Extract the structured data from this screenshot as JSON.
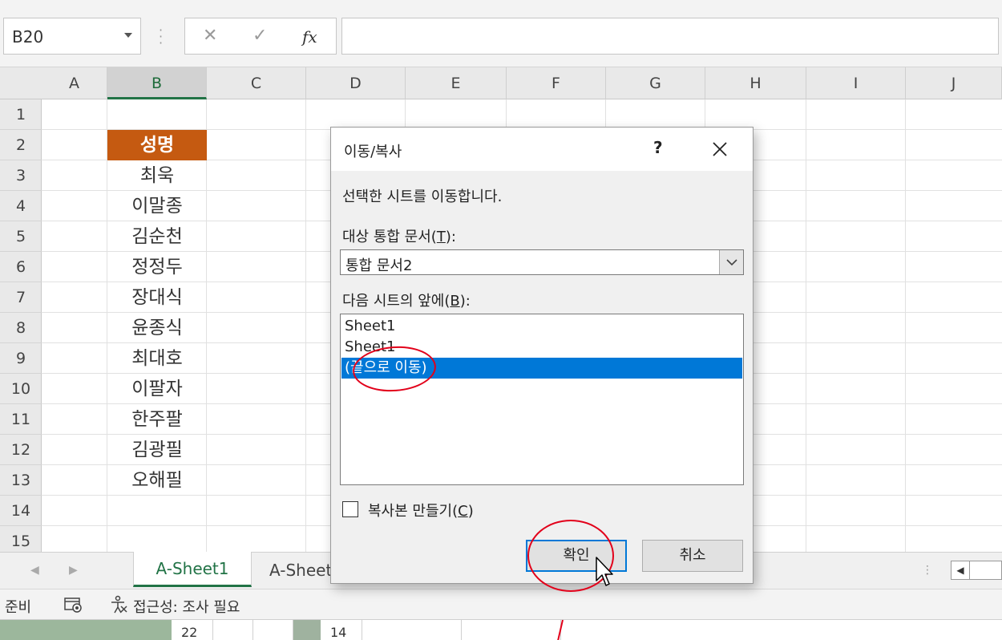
{
  "formula_bar": {
    "name_box": "B20",
    "cancel_symbol": "✕",
    "enter_symbol": "✓",
    "fx_symbol": "fx",
    "formula": ""
  },
  "columns": [
    "A",
    "B",
    "C",
    "D",
    "E",
    "F",
    "G",
    "H",
    "I",
    "J"
  ],
  "active_column": "B",
  "rows": [
    "1",
    "2",
    "3",
    "4",
    "5",
    "6",
    "7",
    "8",
    "9",
    "10",
    "11",
    "12",
    "13",
    "14",
    "15"
  ],
  "column_b": {
    "header": "성명",
    "names": [
      "최욱",
      "이말종",
      "김순천",
      "정정두",
      "장대식",
      "윤종식",
      "최대호",
      "이팔자",
      "한주팔",
      "김광필",
      "오해필"
    ]
  },
  "sheet_tabs": {
    "tabs": [
      "A-Sheet1",
      "A-Sheet"
    ],
    "active": "A-Sheet1"
  },
  "status_bar": {
    "ready": "준비",
    "accessibility": "접근성: 조사 필요"
  },
  "bottom_strip": {
    "row_a": "22",
    "row_b": "14"
  },
  "dialog": {
    "title": "이동/복사",
    "help": "?",
    "description": "선택한 시트를 이동합니다.",
    "dest_label_pre": "대상 통합 문서(",
    "dest_label_key": "T",
    "dest_label_post": "):",
    "dest_value": "통합 문서2",
    "before_label_pre": "다음 시트의 앞에(",
    "before_label_key": "B",
    "before_label_post": "):",
    "list_items": [
      "Sheet1",
      "Sheet1",
      "(끝으로 이동)"
    ],
    "selected_index": 2,
    "copy_label_pre": "복사본 만들기(",
    "copy_label_key": "C",
    "copy_label_post": ")",
    "copy_checked": false,
    "ok": "확인",
    "cancel": "취소"
  },
  "colors": {
    "header_fill": "#c55a11",
    "selection": "#0078d7",
    "excel_green": "#217346",
    "annotation_red": "#e2001a"
  }
}
